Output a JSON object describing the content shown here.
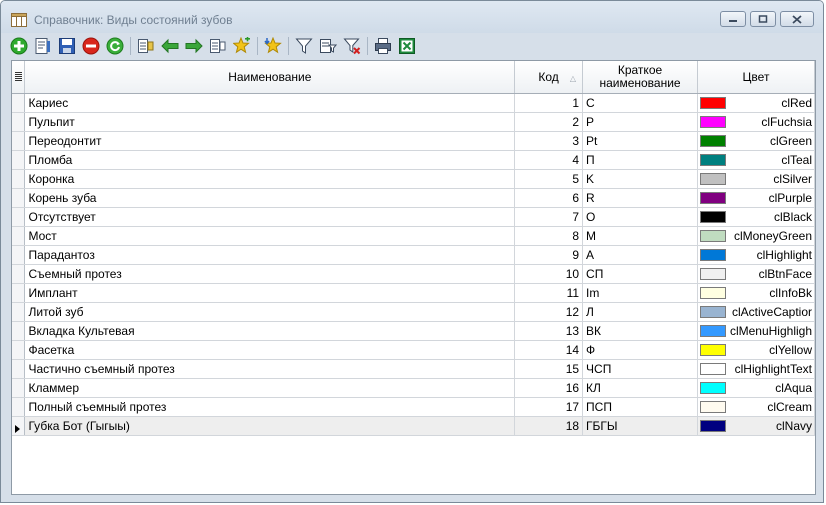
{
  "window": {
    "title": "Справочник: Виды состояний зубов"
  },
  "toolbar": {
    "buttons": [
      {
        "name": "add",
        "icon": "plus-circle-icon"
      },
      {
        "name": "edit",
        "icon": "edit-document-icon"
      },
      {
        "name": "save",
        "icon": "save-disk-icon"
      },
      {
        "name": "delete",
        "icon": "delete-circle-icon"
      },
      {
        "name": "refresh",
        "icon": "refresh-icon"
      },
      {
        "name": "copy-columns",
        "icon": "columns-icon"
      },
      {
        "name": "move-left",
        "icon": "arrow-left-icon"
      },
      {
        "name": "move-right",
        "icon": "arrow-right-icon"
      },
      {
        "name": "columns-2",
        "icon": "columns-icon"
      },
      {
        "name": "star-add",
        "icon": "star-plus-icon"
      },
      {
        "name": "star-down",
        "icon": "star-down-icon"
      },
      {
        "name": "filter",
        "icon": "filter-icon"
      },
      {
        "name": "filter-edit",
        "icon": "filter-edit-icon"
      },
      {
        "name": "filter-clear",
        "icon": "filter-clear-icon"
      },
      {
        "name": "print",
        "icon": "printer-icon"
      },
      {
        "name": "excel",
        "icon": "excel-icon"
      }
    ]
  },
  "grid": {
    "columns": {
      "name": "Наименование",
      "code": "Код",
      "short_line1": "Краткое",
      "short_line2": "наименование",
      "color": "Цвет"
    },
    "current_row": 17,
    "rows": [
      {
        "name": "Кариес",
        "code": "1",
        "short": "C",
        "color_name": "clRed",
        "color": "#ff0000"
      },
      {
        "name": "Пульпит",
        "code": "2",
        "short": "P",
        "color_name": "clFuchsia",
        "color": "#ff00ff"
      },
      {
        "name": "Переодонтит",
        "code": "3",
        "short": "Pt",
        "color_name": "clGreen",
        "color": "#008000"
      },
      {
        "name": "Пломба",
        "code": "4",
        "short": "П",
        "color_name": "clTeal",
        "color": "#008080"
      },
      {
        "name": "Коронка",
        "code": "5",
        "short": "K",
        "color_name": "clSilver",
        "color": "#c0c0c0"
      },
      {
        "name": "Корень зуба",
        "code": "6",
        "short": "R",
        "color_name": "clPurple",
        "color": "#800080"
      },
      {
        "name": "Отсутствует",
        "code": "7",
        "short": "O",
        "color_name": "clBlack",
        "color": "#000000"
      },
      {
        "name": "Мост",
        "code": "8",
        "short": "M",
        "color_name": "clMoneyGreen",
        "color": "#c0dcc0"
      },
      {
        "name": "Парадантоз",
        "code": "9",
        "short": "A",
        "color_name": "clHighlight",
        "color": "#0078d7"
      },
      {
        "name": "Съемный протез",
        "code": "10",
        "short": "СП",
        "color_name": "clBtnFace",
        "color": "#f0f0f0"
      },
      {
        "name": "Имплант",
        "code": "11",
        "short": "Im",
        "color_name": "clInfoBk",
        "color": "#ffffe1"
      },
      {
        "name": "Литой зуб",
        "code": "12",
        "short": "Л",
        "color_name": "clActiveCaptior",
        "color": "#99b4d1"
      },
      {
        "name": "Вкладка Культевая",
        "code": "13",
        "short": "ВК",
        "color_name": "clMenuHighligh",
        "color": "#3399ff"
      },
      {
        "name": "Фасетка",
        "code": "14",
        "short": "Ф",
        "color_name": "clYellow",
        "color": "#ffff00"
      },
      {
        "name": "Частично съемный протез",
        "code": "15",
        "short": "ЧСП",
        "color_name": "clHighlightText",
        "color": "#ffffff"
      },
      {
        "name": "Кламмер",
        "code": "16",
        "short": "КЛ",
        "color_name": "clAqua",
        "color": "#00ffff"
      },
      {
        "name": "Полный съемный протез",
        "code": "17",
        "short": "ПСП",
        "color_name": "clCream",
        "color": "#fffbf0"
      },
      {
        "name": "Губка Бот (Гыгыы)",
        "code": "18",
        "short": "ГБГЫ",
        "color_name": "clNavy",
        "color": "#000080"
      }
    ]
  }
}
